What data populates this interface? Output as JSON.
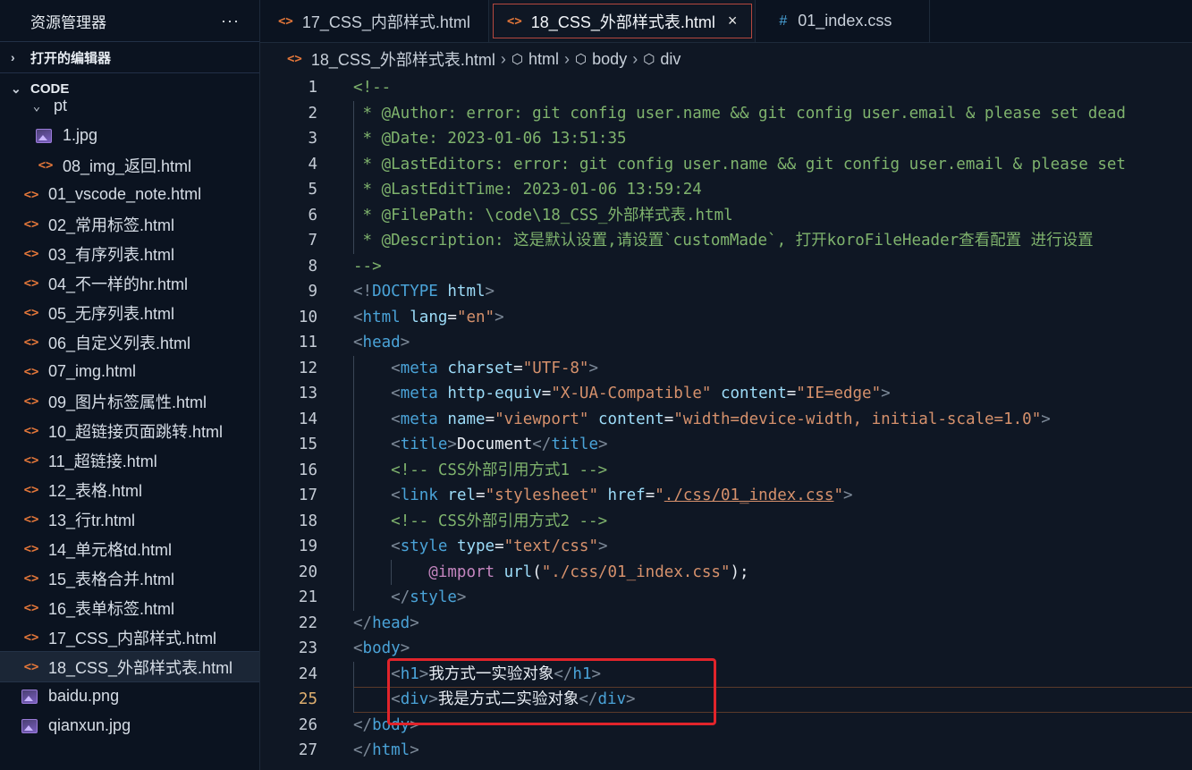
{
  "sidebar": {
    "title": "资源管理器",
    "more": "···",
    "open_editors": "打开的编辑器",
    "workspace": "CODE",
    "items": [
      {
        "label": "pt",
        "type": "folder",
        "indent": 1
      },
      {
        "label": "1.jpg",
        "type": "image",
        "indent": 2
      },
      {
        "label": "08_img_返回.html",
        "type": "html",
        "indent": 2
      },
      {
        "label": "01_vscode_note.html",
        "type": "html",
        "indent": 0
      },
      {
        "label": "02_常用标签.html",
        "type": "html",
        "indent": 0
      },
      {
        "label": "03_有序列表.html",
        "type": "html",
        "indent": 0
      },
      {
        "label": "04_不一样的hr.html",
        "type": "html",
        "indent": 0
      },
      {
        "label": "05_无序列表.html",
        "type": "html",
        "indent": 0
      },
      {
        "label": "06_自定义列表.html",
        "type": "html",
        "indent": 0
      },
      {
        "label": "07_img.html",
        "type": "html",
        "indent": 0
      },
      {
        "label": "09_图片标签属性.html",
        "type": "html",
        "indent": 0
      },
      {
        "label": "10_超链接页面跳转.html",
        "type": "html",
        "indent": 0
      },
      {
        "label": "11_超链接.html",
        "type": "html",
        "indent": 0
      },
      {
        "label": "12_表格.html",
        "type": "html",
        "indent": 0
      },
      {
        "label": "13_行tr.html",
        "type": "html",
        "indent": 0
      },
      {
        "label": "14_单元格td.html",
        "type": "html",
        "indent": 0
      },
      {
        "label": "15_表格合并.html",
        "type": "html",
        "indent": 0
      },
      {
        "label": "16_表单标签.html",
        "type": "html",
        "indent": 0
      },
      {
        "label": "17_CSS_内部样式.html",
        "type": "html",
        "indent": 0
      },
      {
        "label": "18_CSS_外部样式表.html",
        "type": "html",
        "indent": 0,
        "active": true
      },
      {
        "label": "baidu.png",
        "type": "image",
        "indent": 0
      },
      {
        "label": "qianxun.jpg",
        "type": "image",
        "indent": 0
      }
    ]
  },
  "tabs": [
    {
      "label": "17_CSS_内部样式.html",
      "icon": "<>"
    },
    {
      "label": "18_CSS_外部样式表.html",
      "icon": "<>",
      "active": true,
      "close": "×"
    },
    {
      "label": "01_index.css",
      "icon": "#"
    }
  ],
  "breadcrumb": {
    "file": "18_CSS_外部样式表.html",
    "parts": [
      "html",
      "body",
      "div"
    ]
  },
  "editor": {
    "current_line": 25,
    "lines": [
      {
        "n": "1",
        "segs": [
          [
            "c-comment",
            "<!--"
          ]
        ]
      },
      {
        "n": "2",
        "segs": [
          [
            "c-comment",
            " * @Author: error: git config user.name && git config user.email & please set dead"
          ]
        ]
      },
      {
        "n": "3",
        "segs": [
          [
            "c-comment",
            " * @Date: 2023-01-06 13:51:35"
          ]
        ]
      },
      {
        "n": "4",
        "segs": [
          [
            "c-comment",
            " * @LastEditors: error: git config user.name && git config user.email & please set"
          ]
        ]
      },
      {
        "n": "5",
        "segs": [
          [
            "c-comment",
            " * @LastEditTime: 2023-01-06 13:59:24"
          ]
        ]
      },
      {
        "n": "6",
        "segs": [
          [
            "c-comment",
            " * @FilePath: \\code\\18_CSS_外部样式表.html"
          ]
        ]
      },
      {
        "n": "7",
        "segs": [
          [
            "c-comment",
            " * @Description: 这是默认设置,请设置`customMade`, 打开koroFileHeader查看配置 进行设置"
          ]
        ]
      },
      {
        "n": "8",
        "segs": [
          [
            "c-comment",
            "-->"
          ]
        ]
      },
      {
        "n": "9",
        "segs": [
          [
            "c-bracket",
            "<!"
          ],
          [
            "c-tag",
            "DOCTYPE"
          ],
          [
            "c-text",
            " "
          ],
          [
            "c-attr",
            "html"
          ],
          [
            "c-bracket",
            ">"
          ]
        ]
      },
      {
        "n": "10",
        "segs": [
          [
            "c-bracket",
            "<"
          ],
          [
            "c-tag",
            "html"
          ],
          [
            "c-text",
            " "
          ],
          [
            "c-attr",
            "lang"
          ],
          [
            "c-text",
            "="
          ],
          [
            "c-str",
            "\"en\""
          ],
          [
            "c-bracket",
            ">"
          ]
        ]
      },
      {
        "n": "11",
        "segs": [
          [
            "c-bracket",
            "<"
          ],
          [
            "c-tag",
            "head"
          ],
          [
            "c-bracket",
            ">"
          ]
        ]
      },
      {
        "n": "12",
        "segs": [
          [
            "c-text",
            "    "
          ],
          [
            "c-bracket",
            "<"
          ],
          [
            "c-tag",
            "meta"
          ],
          [
            "c-text",
            " "
          ],
          [
            "c-attr",
            "charset"
          ],
          [
            "c-text",
            "="
          ],
          [
            "c-str",
            "\"UTF-8\""
          ],
          [
            "c-bracket",
            ">"
          ]
        ]
      },
      {
        "n": "13",
        "segs": [
          [
            "c-text",
            "    "
          ],
          [
            "c-bracket",
            "<"
          ],
          [
            "c-tag",
            "meta"
          ],
          [
            "c-text",
            " "
          ],
          [
            "c-attr",
            "http-equiv"
          ],
          [
            "c-text",
            "="
          ],
          [
            "c-str",
            "\"X-UA-Compatible\""
          ],
          [
            "c-text",
            " "
          ],
          [
            "c-attr",
            "content"
          ],
          [
            "c-text",
            "="
          ],
          [
            "c-str",
            "\"IE=edge\""
          ],
          [
            "c-bracket",
            ">"
          ]
        ]
      },
      {
        "n": "14",
        "segs": [
          [
            "c-text",
            "    "
          ],
          [
            "c-bracket",
            "<"
          ],
          [
            "c-tag",
            "meta"
          ],
          [
            "c-text",
            " "
          ],
          [
            "c-attr",
            "name"
          ],
          [
            "c-text",
            "="
          ],
          [
            "c-str",
            "\"viewport\""
          ],
          [
            "c-text",
            " "
          ],
          [
            "c-attr",
            "content"
          ],
          [
            "c-text",
            "="
          ],
          [
            "c-str",
            "\"width=device-width, initial-scale=1.0\""
          ],
          [
            "c-bracket",
            ">"
          ]
        ]
      },
      {
        "n": "15",
        "segs": [
          [
            "c-text",
            "    "
          ],
          [
            "c-bracket",
            "<"
          ],
          [
            "c-tag",
            "title"
          ],
          [
            "c-bracket",
            ">"
          ],
          [
            "c-text",
            "Document"
          ],
          [
            "c-bracket",
            "</"
          ],
          [
            "c-tag",
            "title"
          ],
          [
            "c-bracket",
            ">"
          ]
        ]
      },
      {
        "n": "16",
        "segs": [
          [
            "c-text",
            "    "
          ],
          [
            "c-comment",
            "<!-- CSS外部引用方式1 -->"
          ]
        ]
      },
      {
        "n": "17",
        "segs": [
          [
            "c-text",
            "    "
          ],
          [
            "c-bracket",
            "<"
          ],
          [
            "c-tag",
            "link"
          ],
          [
            "c-text",
            " "
          ],
          [
            "c-attr",
            "rel"
          ],
          [
            "c-text",
            "="
          ],
          [
            "c-str",
            "\"stylesheet\""
          ],
          [
            "c-text",
            " "
          ],
          [
            "c-attr",
            "href"
          ],
          [
            "c-text",
            "="
          ],
          [
            "c-str",
            "\""
          ],
          [
            "c-link",
            "./css/01_index.css"
          ],
          [
            "c-str",
            "\""
          ],
          [
            "c-bracket",
            ">"
          ]
        ]
      },
      {
        "n": "18",
        "segs": [
          [
            "c-text",
            "    "
          ],
          [
            "c-comment",
            "<!-- CSS外部引用方式2 -->"
          ]
        ]
      },
      {
        "n": "19",
        "segs": [
          [
            "c-text",
            "    "
          ],
          [
            "c-bracket",
            "<"
          ],
          [
            "c-tag",
            "style"
          ],
          [
            "c-text",
            " "
          ],
          [
            "c-attr",
            "type"
          ],
          [
            "c-text",
            "="
          ],
          [
            "c-str",
            "\"text/css\""
          ],
          [
            "c-bracket",
            ">"
          ]
        ]
      },
      {
        "n": "20",
        "segs": [
          [
            "c-text",
            "        "
          ],
          [
            "c-kw",
            "@import"
          ],
          [
            "c-text",
            " "
          ],
          [
            "c-attr",
            "url"
          ],
          [
            "c-text",
            "("
          ],
          [
            "c-str",
            "\"./css/01_index.css\""
          ],
          [
            "c-text",
            ");"
          ]
        ]
      },
      {
        "n": "21",
        "segs": [
          [
            "c-text",
            "    "
          ],
          [
            "c-bracket",
            "</"
          ],
          [
            "c-tag",
            "style"
          ],
          [
            "c-bracket",
            ">"
          ]
        ]
      },
      {
        "n": "22",
        "segs": [
          [
            "c-bracket",
            "</"
          ],
          [
            "c-tag",
            "head"
          ],
          [
            "c-bracket",
            ">"
          ]
        ]
      },
      {
        "n": "23",
        "segs": [
          [
            "c-bracket",
            "<"
          ],
          [
            "c-tag",
            "body"
          ],
          [
            "c-bracket",
            ">"
          ]
        ]
      },
      {
        "n": "24",
        "segs": [
          [
            "c-text",
            "    "
          ],
          [
            "c-bracket",
            "<"
          ],
          [
            "c-tag",
            "h1"
          ],
          [
            "c-bracket",
            ">"
          ],
          [
            "c-text",
            "我方式一实验对象"
          ],
          [
            "c-bracket",
            "</"
          ],
          [
            "c-tag",
            "h1"
          ],
          [
            "c-bracket",
            ">"
          ]
        ]
      },
      {
        "n": "25",
        "segs": [
          [
            "c-text",
            "    "
          ],
          [
            "c-bracket",
            "<"
          ],
          [
            "c-tag",
            "div"
          ],
          [
            "c-bracket",
            ">"
          ],
          [
            "c-text",
            "我是方式二实验对象"
          ],
          [
            "c-bracket",
            "</"
          ],
          [
            "c-tag",
            "div"
          ],
          [
            "c-bracket",
            ">"
          ]
        ]
      },
      {
        "n": "26",
        "segs": [
          [
            "c-bracket",
            "</"
          ],
          [
            "c-tag",
            "body"
          ],
          [
            "c-bracket",
            ">"
          ]
        ]
      },
      {
        "n": "27",
        "segs": [
          [
            "c-bracket",
            "</"
          ],
          [
            "c-tag",
            "html"
          ],
          [
            "c-bracket",
            ">"
          ]
        ]
      }
    ]
  },
  "colors": {
    "highlight_box": "#e1242b",
    "html_icon": "#e4773a",
    "css_icon": "#4aa3d8"
  }
}
